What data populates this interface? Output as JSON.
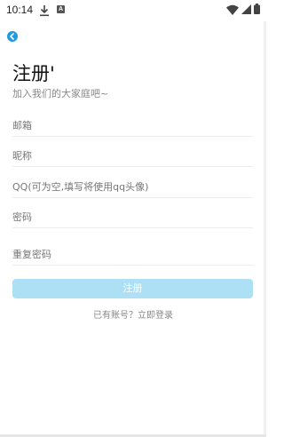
{
  "status_bar": {
    "time": "10:14",
    "notification_icons": [
      "download-icon",
      "a-icon"
    ],
    "a_glyph": "A",
    "system_icons": [
      "wifi-icon",
      "signal-icon",
      "battery-icon"
    ]
  },
  "header": {
    "back_icon": "chevron-left-icon",
    "accent_color": "#1e9be0"
  },
  "title": {
    "main": "注册'",
    "subtitle": "加入我们的大家庭吧~"
  },
  "form": {
    "fields": [
      {
        "name": "email",
        "placeholder": "邮箱"
      },
      {
        "name": "nickname",
        "placeholder": "昵称"
      },
      {
        "name": "qq",
        "placeholder": "QQ(可为空,填写将使用qq头像)"
      },
      {
        "name": "password",
        "placeholder": "密码"
      },
      {
        "name": "confirm_password",
        "placeholder": "重复密码"
      }
    ],
    "submit_label": "注册",
    "submit_color": "#ade0f4"
  },
  "footer": {
    "login_link": "已有账号？立即登录"
  }
}
